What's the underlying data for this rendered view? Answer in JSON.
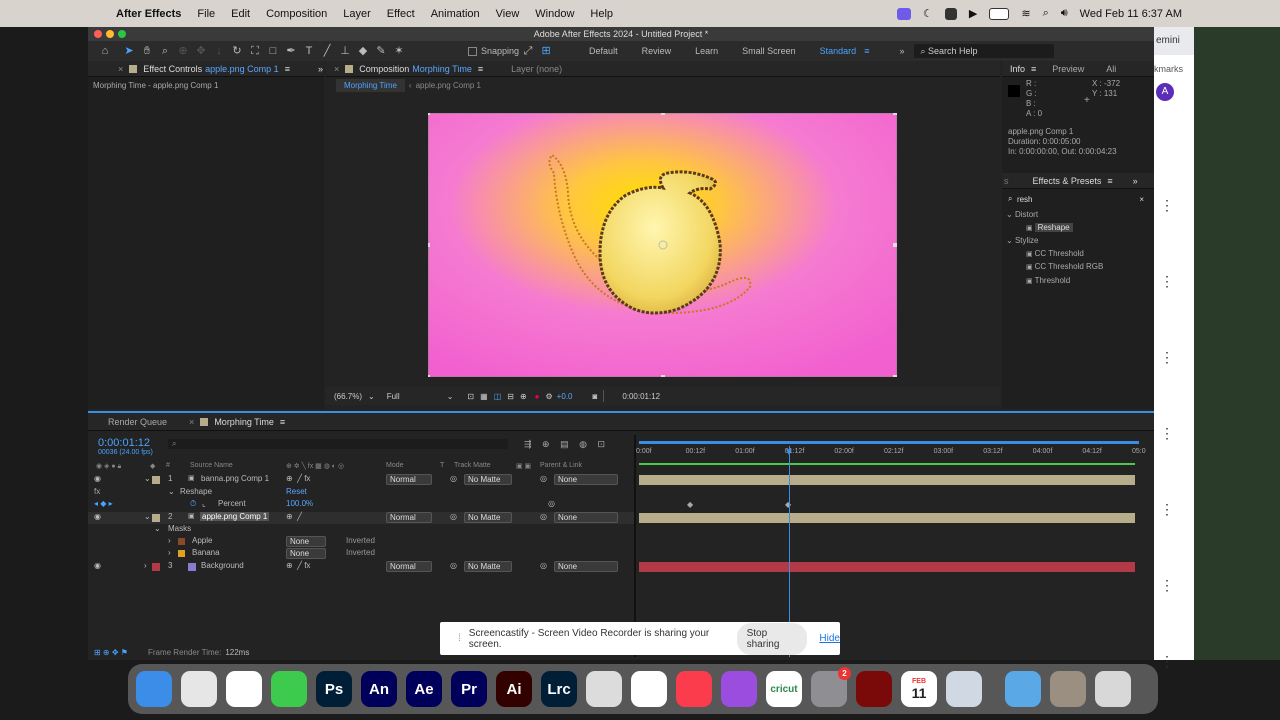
{
  "menubar": {
    "app_name": "After Effects",
    "items": [
      "File",
      "Edit",
      "Composition",
      "Layer",
      "Effect",
      "Animation",
      "View",
      "Window",
      "Help"
    ],
    "datetime": "Wed Feb 11  6:37 AM"
  },
  "window": {
    "title": "Adobe After Effects 2024 - Untitled Project *"
  },
  "toolbar": {
    "snapping": "Snapping",
    "workspaces": [
      "Default",
      "Review",
      "Learn",
      "Small Screen",
      "Standard"
    ],
    "active_workspace": "Standard",
    "search_placeholder": "Search Help"
  },
  "effect_controls": {
    "tab_prefix": "Effect Controls",
    "tab_layer": "apple.png Comp 1",
    "breadcrumb": "Morphing Time - apple.png Comp 1"
  },
  "composition": {
    "tab_prefix": "Composition",
    "tab_name": "Morphing Time",
    "layer_tab": "Layer (none)",
    "crumb_active": "Morphing Time",
    "crumb_next": "apple.png Comp 1",
    "zoom": "(66.7%)",
    "resolution": "Full",
    "exposure": "+0.0",
    "timecode": "0:00:01:12"
  },
  "info": {
    "tabs": [
      "Info",
      "Preview",
      "Ali"
    ],
    "r": "R :",
    "g": "G :",
    "b": "B :",
    "a": "A :  0",
    "x": "X : -372",
    "y": "Y :  131",
    "comp_name": "apple.png Comp 1",
    "duration": "Duration: 0:00:05:00",
    "in_out": "In: 0:00:00:00, Out: 0:00:04:23"
  },
  "effects_presets": {
    "title": "Effects & Presets",
    "search": "resh",
    "groups": [
      {
        "name": "Distort",
        "items": [
          "Reshape"
        ]
      },
      {
        "name": "Stylize",
        "items": [
          "CC Threshold",
          "CC Threshold RGB",
          "Threshold"
        ]
      }
    ]
  },
  "timeline": {
    "tab_render": "Render Queue",
    "tab_comp": "Morphing Time",
    "timecode": "0:00:01:12",
    "fps": "00036 (24.00 fps)",
    "headers": {
      "source": "Source Name",
      "mode": "Mode",
      "t": "T",
      "matte": "Track Matte",
      "parent": "Parent & Link"
    },
    "ruler": [
      "0:00f",
      "00:12f",
      "01:00f",
      "01:12f",
      "02:00f",
      "02:12f",
      "03:00f",
      "03:12f",
      "04:00f",
      "04:12f",
      "05:0"
    ],
    "layers": [
      {
        "num": "1",
        "name": "banna.png Comp 1",
        "mode": "Normal",
        "matte": "No Matte",
        "parent": "None"
      },
      {
        "num": "2",
        "name": "apple.png Comp 1",
        "mode": "Normal",
        "matte": "No Matte",
        "parent": "None"
      },
      {
        "num": "3",
        "name": "Background",
        "mode": "Normal",
        "matte": "No Matte",
        "parent": "None"
      }
    ],
    "reshape_label": "Reshape",
    "reshape_reset": "Reset",
    "percent_label": "Percent",
    "percent_value": "100.0%",
    "masks_label": "Masks",
    "masks": [
      {
        "name": "Apple",
        "mode": "None",
        "inverted": "Inverted"
      },
      {
        "name": "Banana",
        "mode": "None",
        "inverted": "Inverted"
      }
    ],
    "frame_render_label": "Frame Render Time:",
    "frame_render_value": "122ms"
  },
  "chrome": {
    "partial_text": "emini",
    "bookmarks": "kmarks",
    "avatar": "A"
  },
  "share_bar": {
    "message": "Screencastify - Screen Video Recorder is sharing your screen.",
    "stop": "Stop sharing",
    "hide": "Hide"
  },
  "dock": {
    "apps": [
      {
        "name": "Finder",
        "label": "",
        "color": "#3b8de8"
      },
      {
        "name": "Launchpad",
        "label": "",
        "color": "#e6e6e6"
      },
      {
        "name": "Chrome",
        "label": "",
        "color": "#ffffff"
      },
      {
        "name": "Messages",
        "label": "",
        "color": "#3ccb4c"
      },
      {
        "name": "Photoshop",
        "label": "Ps",
        "color": "#001e36"
      },
      {
        "name": "Animate",
        "label": "An",
        "color": "#00005b"
      },
      {
        "name": "After Effects",
        "label": "Ae",
        "color": "#00005b"
      },
      {
        "name": "Premiere Pro",
        "label": "Pr",
        "color": "#00005b"
      },
      {
        "name": "Illustrator",
        "label": "Ai",
        "color": "#330000"
      },
      {
        "name": "Lightroom Classic",
        "label": "Lrc",
        "color": "#001e36"
      },
      {
        "name": "QuickTime",
        "label": "",
        "color": "#dcdcdc"
      },
      {
        "name": "Photos",
        "label": "",
        "color": "#ffffff"
      },
      {
        "name": "Music",
        "label": "",
        "color": "#fa3c4c"
      },
      {
        "name": "Podcasts",
        "label": "",
        "color": "#9b4de0"
      },
      {
        "name": "Cricut",
        "label": "cricut",
        "color": "#ffffff"
      },
      {
        "name": "System Settings",
        "label": "",
        "color": "#8e8e93"
      },
      {
        "name": "Flash",
        "label": "",
        "color": "#7a0a0a"
      },
      {
        "name": "Calendar",
        "label": "11",
        "color": "#ffffff"
      },
      {
        "name": "Preview",
        "label": "",
        "color": "#cfd8e3"
      },
      {
        "name": "Folder",
        "label": "",
        "color": "#5aa9e6"
      },
      {
        "name": "Downloads",
        "label": "",
        "color": "#9a8f80"
      },
      {
        "name": "Trash",
        "label": "",
        "color": "#d8d8d8"
      }
    ],
    "settings_badge": "2",
    "calendar_month": "FEB"
  },
  "colors": {
    "accent": "#4aa3ff",
    "comp_bg": "#f25fcf",
    "label_tan": "#b8ad8a",
    "label_red": "#b23a46"
  }
}
